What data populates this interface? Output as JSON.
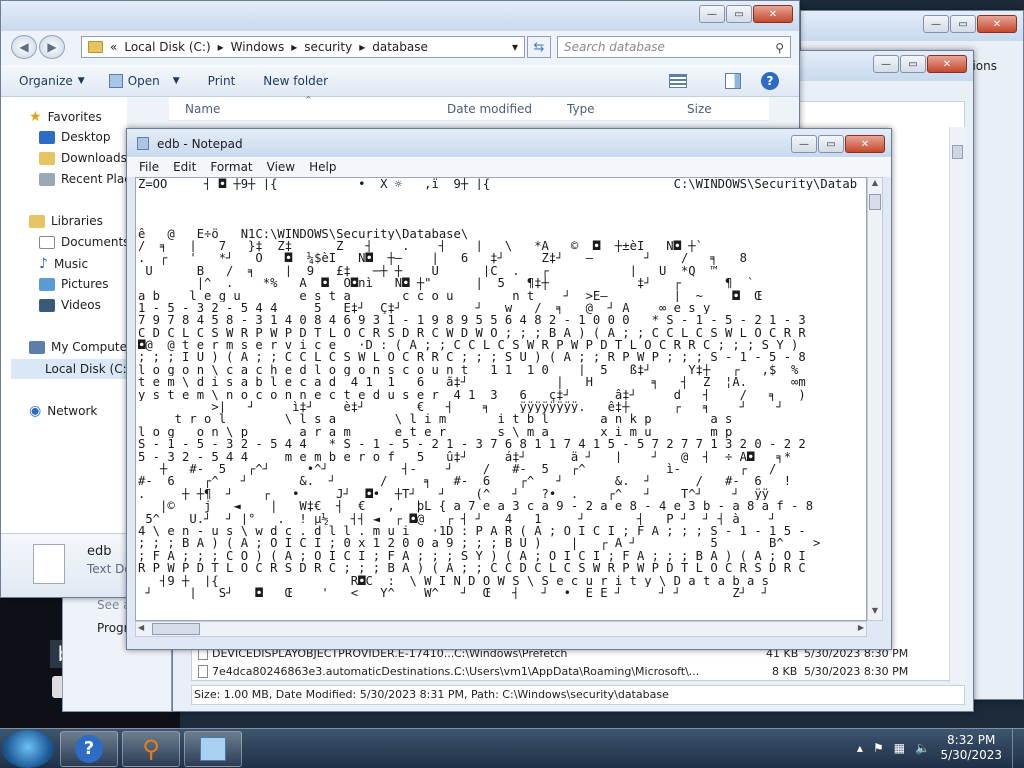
{
  "explorer": {
    "breadcrumb": [
      "Local Disk (C:)",
      "Windows",
      "security",
      "database"
    ],
    "search_placeholder": "Search database",
    "toolbar": {
      "organize": "Organize",
      "open": "Open",
      "print": "Print",
      "new_folder": "New folder"
    },
    "nav": {
      "favorites": "Favorites",
      "desktop": "Desktop",
      "downloads": "Downloads",
      "recent_places": "Recent Places",
      "libraries": "Libraries",
      "documents": "Documents",
      "music": "Music",
      "pictures": "Pictures",
      "videos": "Videos",
      "my_computer": "My Computer",
      "local_disk": "Local Disk (C:)",
      "network": "Network"
    },
    "columns": {
      "name": "Name",
      "date_modified": "Date modified",
      "type": "Type",
      "size": "Size"
    },
    "details": {
      "file_name": "edb",
      "file_type": "Text Document"
    }
  },
  "background_window": {
    "title_fragment": "ions",
    "rows": [
      {
        "name": "DEVICEDISPLAYOBJECTPROVIDER.E-17410...",
        "path": "C:\\Windows\\Prefetch",
        "size": "41 KB",
        "date": "5/30/2023 8:30 PM"
      },
      {
        "name": "7e4dca80246863e3.automaticDestinations...",
        "path": "C:\\Users\\vm1\\AppData\\Roaming\\Microsoft\\...",
        "size": "8 KB",
        "date": "5/30/2023 8:30 PM"
      }
    ],
    "status": "Size: 1.00 MB, Date Modified: 5/30/2023 8:31 PM, Path: C:\\Windows\\security\\database",
    "left_fragments": [
      "See a",
      "Progr"
    ]
  },
  "notepad": {
    "title": "edb - Notepad",
    "menu": [
      "File",
      "Edit",
      "Format",
      "View",
      "Help"
    ],
    "lines": [
      "Z=ÖÕ     ┤ ◘ ┼9┼ |{           •  X ☼   ,ï  9┼ |{                         C:\\WINDOWS\\Security\\Datab",
      "",
      "",
      "",
      "ê   @   É÷ö   Ñ1C:\\WINDOWS\\Security\\Database\\",
      "/  ╕   |   7   }‡  Z‡      Z   ┤    .    ┤    |   \\   *A   ©  ◘  ┼±èÎ   Ñ◘ ┼`",
      ".  ┌   '   *┘   Ö   ◘  ¼$èÎ   Ñ◘  ┼—    |   6   ‡┘     Ž‡┘   —       ┘    /   ╕   8",
      " Ú      B   /  ╕    |  9   £‡   ─┼ ┼    Ú      |C  .   ┌           |   Ü  *Q  ™",
      "        |^  .    *%   À  ◘  Õ◘nì   Ñ◘ ┼\"      |  5   ¶‡┼            ‡┘   ┌      ¶  `",
      "a b    l e g u        e s t a       c c o u        n t    ┘  >E—         |  ~    ◘  Œ",
      "1 - 5 - 3 2 - 5 4 4     5   É‡┘  Ç‡┘          ┘   w   /  ╕   @  ┘ À    ∞ e s y",
      "7 9 7 8 4 5 8 - 3 1 4 0 8 4 6 9 3 1 - 1 9 8 9 5 5 6 4 8 2 - 1 0 0 0   * S - 1 - 5 - 2 1 - 3",
      "C D C L C S W R P W P D T L O C R S D R C W D W O ; ; ; B A ) ( A ; ; C C L C S W L O C R R",
      "◘@  @ t e r m s e r v i c e   ·D : ( A ; ; C C L C S W R P W P D T L O C R R C ; ; ; S Y )",
      "; ; ; I U ) ( A ; ; C C L C S W L O C R R C ; ; ; S U ) ( A ; ; R P W P ; ; ; S - 1 - 5 - 8",
      "l o g o n \\ c a c h e d l o g o n s c o u n t   1 1  1 0    |  5   ß‡┘     Ý‡┼   ┌   ,$  %",
      "t e m \\ d i s a b l e c a d  4 1  1   6   ã‡┘            |   H        ╕   ┤  Ž  ¦À.      ∞m",
      "y s t e m \\ n o c o n n e c t e d u s e r  4 1  3   6   ç‡┘      â‡┘     d   ┤    /   ╕   )",
      "          >|   ┘     ì‡┘    è‡┘       €   ┤    ╕    ÿÿÿÿÿÿÿÿ.   ê‡┼      ┌   ╕    ┘    ┘",
      "     t r o l        \\ l s a        \\ l i m       i t b l       a n k p        a s",
      "l o g   o n \\ p       a r a m      e t e r       s \\ m a       x i m u        m p",
      "S - 1 - 5 - 3 2 - 5 4 4   * S - 1 - 5 - 2 1 - 3 7 6 8 1 1 7 4 1 5 - 5 7 2 7 7 1 3 2 0 - 2 2",
      "5 - 3 2 - 5 4 4 _ _ m e m b e r o f   5   û‡┘     á‡┘      ä ┘   |    ┘   @  ┤  ÷ À◘   ╕*",
      "   ┼   #-  5   ┌^┘     •^┘          ┤-    ┘    /   #-  5   ┌^           ì-        ┌   /",
      "#-  6    ┌^   ┘       &.  ┘      /     ╕   #-  6    ┌^   ┘       &.  ┘      /   #-  6   !",
      ".     ┼ ┼¶  ┘    ┌   •     J┘  ◘•  ┼T┘   ┘    (^   ┘   ?•  .    ┌^   ┘    T^┘    ┘  ÿÿ",
      "   |©    j   ◄    |   W‡€  ┤  €   ,   þL { a 7 e a 3 c a 9 - 2 a e 8 - 4 e 3 b - a 8 a f - 8",
      " 5^    Ü.┘  ┘ |°   .  ! µ½   ┤┤ ◄  ┌ ◘@   ┌ ┤ ┘   4   1     ┘       ┤   P ┘  ┘ ┤ à    ┘",
      "4 \\ e n - u s \\ w d c . d l l . m u i   ·1D : P A R ( A ; O I C I ; F A ; ; ; S - 1 - 1 5 -",
      "; ; ; B A ) ( A ; O I C I ; 0 x 1 2 0 0 a 9 ; ; ; B U )    |   ┌ A ┘          5       B^    >",
      "; F A ; ; ; C O ) ( A ; O I C I ; F A ; ; ; S Y ) ( A ; O I C I ; F A ; ; ; B A ) ( A ; O I",
      "R P W P D T L O C R S D R C ; ; ; B A ) ( A ; ; C C D C L C S W R P W P D T L O C R S D R C",
      "   ┤9 ┼  |{                  R◘C  :  \\ W I N D O W S \\ S e c u r i t y \\ D a t a b a s",
      " ┘     |   Š┘   ◘   Œ    '   <   Y^    W^   ┘  Œ   ┤   ┘  •  É É ┘     ┘ ┘       Ž┘  ┘"
    ]
  },
  "taskbar": {
    "time": "8:32 PM",
    "date": "5/30/2023"
  }
}
